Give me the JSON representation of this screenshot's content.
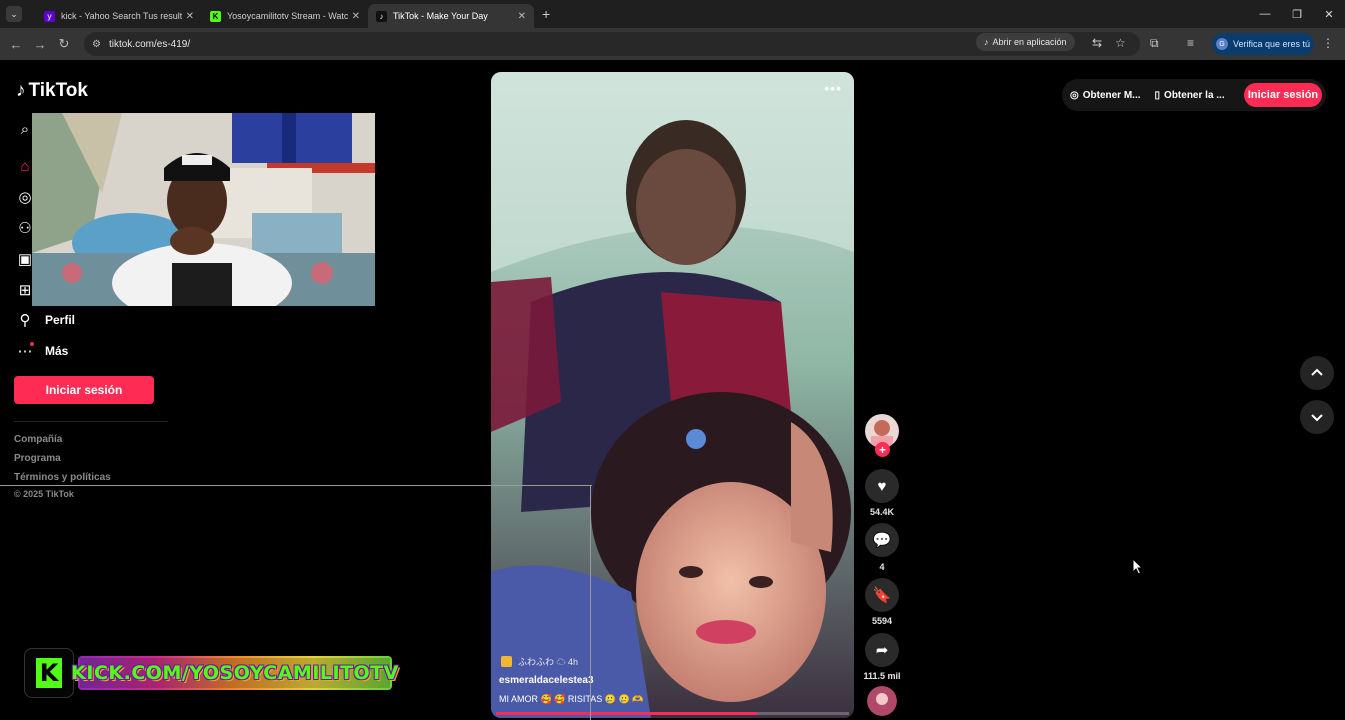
{
  "browser": {
    "tabs": [
      {
        "title": "kick - Yahoo Search Tus resultados",
        "favicon": "yahoo-icon",
        "color": "#6001d2",
        "active": false
      },
      {
        "title": "Yosoycamilitotv Stream - Watch",
        "favicon": "kick-icon",
        "color": "#53fc18",
        "active": false
      },
      {
        "title": "TikTok - Make Your Day",
        "favicon": "tiktok-icon",
        "color": "#111111",
        "active": true
      }
    ],
    "url": "tiktok.com/es-419/",
    "open_in_app": "Abrir en aplicación",
    "verify_profile": "Verifica que eres tú"
  },
  "sidebar": {
    "logo": "TikTok",
    "items": [
      {
        "label": "Perfil",
        "icon": "person-icon"
      },
      {
        "label": "Más",
        "icon": "more-icon"
      }
    ],
    "login_button": "Iniciar sesión",
    "footer_links": [
      "Compañía",
      "Programa",
      "Términos y políticas"
    ],
    "copyright": "© 2025 TikTok"
  },
  "video": {
    "sound_tag": "ふわふわ ☁ 4h",
    "author": "esmeraldacelestea3",
    "caption": "MI AMOR 🥰 🥰 RISITAS 🥲 🥲 🫶",
    "progress": 0.74
  },
  "actions": {
    "likes": "54.4K",
    "comments": "4",
    "saves": "5594",
    "shares": "111.5 mil"
  },
  "top_bar": {
    "get_coins": "Obtener M...",
    "get_app": "Obtener la ...",
    "login": "Iniciar sesión"
  },
  "overlay": {
    "kick_banner": "KICK.COM/YOSOYCAMILITOTV"
  },
  "colors": {
    "accent": "#fe2c55",
    "kick_green": "#53fc18"
  }
}
